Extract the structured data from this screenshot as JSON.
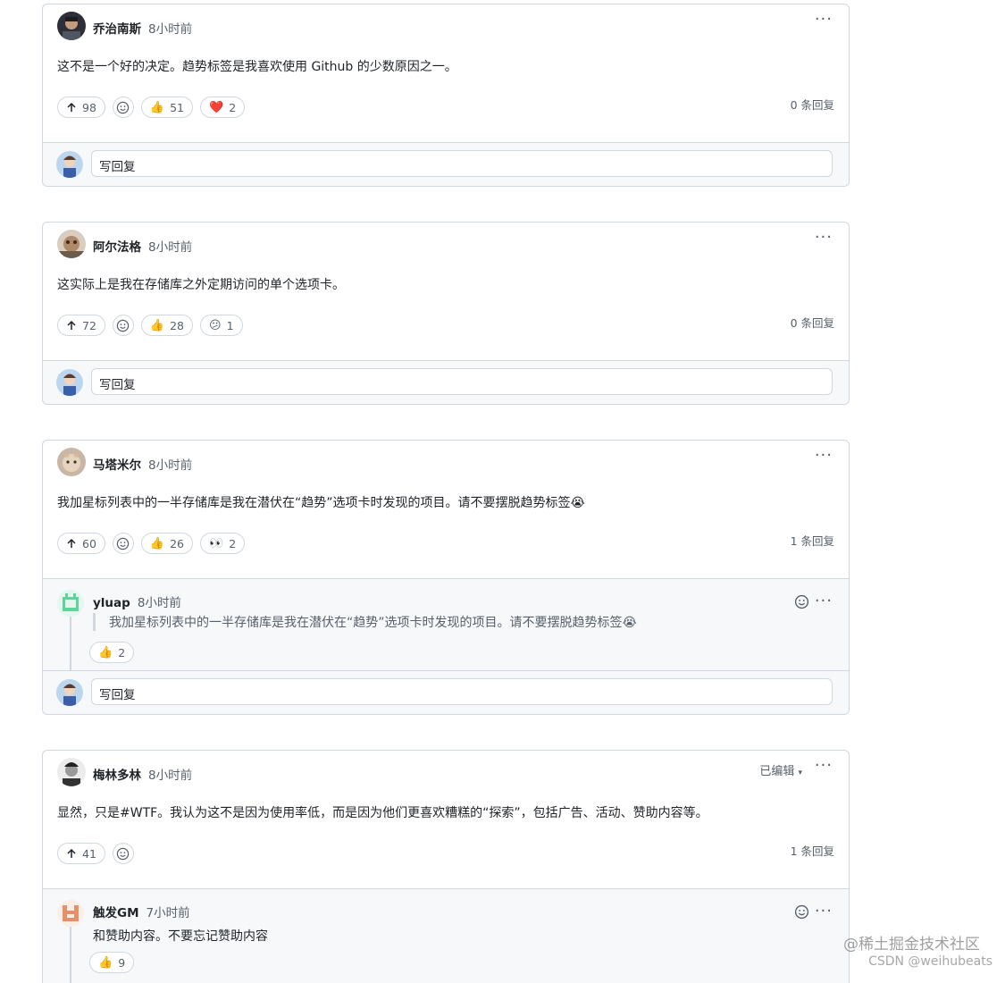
{
  "reply_placeholder": "写回复",
  "threads": [
    {
      "author": "乔治南斯",
      "time": "8小时前",
      "body": "这不是一个好的决定。趋势标签是我喜欢使用 Github 的少数原因之一。",
      "upvotes": "98",
      "reactions": [
        {
          "emoji": "👍",
          "count": "51"
        },
        {
          "emoji": "❤️",
          "count": "2"
        }
      ],
      "replies_count": "0 条回复"
    },
    {
      "author": "阿尔法格",
      "time": "8小时前",
      "body": "这实际上是我在存储库之外定期访问的单个选项卡。",
      "upvotes": "72",
      "reactions": [
        {
          "emoji": "👍",
          "count": "28"
        },
        {
          "emoji": "😕",
          "count": "1"
        }
      ],
      "replies_count": "0 条回复"
    },
    {
      "author": "马塔米尔",
      "time": "8小时前",
      "body": "我加星标列表中的一半存储库是我在潜伏在“趋势”选项卡时发现的项目。请不要摆脱趋势标签😭",
      "upvotes": "60",
      "reactions": [
        {
          "emoji": "👍",
          "count": "26"
        },
        {
          "emoji": "👀",
          "count": "2"
        }
      ],
      "replies_count": "1 条回复",
      "reply": {
        "author": "yluap",
        "time": "8小时前",
        "quote": "我加星标列表中的一半存储库是我在潜伏在“趋势”选项卡时发现的项目。请不要摆脱趋势标签😭",
        "reaction": {
          "emoji": "👍",
          "count": "2"
        }
      }
    },
    {
      "author": "梅林多林",
      "time": "8小时前",
      "edited_label": "已编辑",
      "body": "显然，只是#WTF。我认为这不是因为使用率低，而是因为他们更喜欢糟糕的“探索”，包括广告、活动、赞助内容等。",
      "upvotes": "41",
      "replies_count": "1 条回复",
      "reply": {
        "author": "触发GM",
        "time": "7小时前",
        "text": "和赞助内容。不要忘记赞助内容",
        "reaction": {
          "emoji": "👍",
          "count": "9"
        }
      }
    }
  ],
  "watermark": {
    "line1": "@稀土掘金技术社区",
    "line2": "CSDN @weihubeats"
  },
  "icons": [
    "arrow-up-icon",
    "smiley-icon",
    "kebab-icon",
    "triangle-down-icon"
  ]
}
